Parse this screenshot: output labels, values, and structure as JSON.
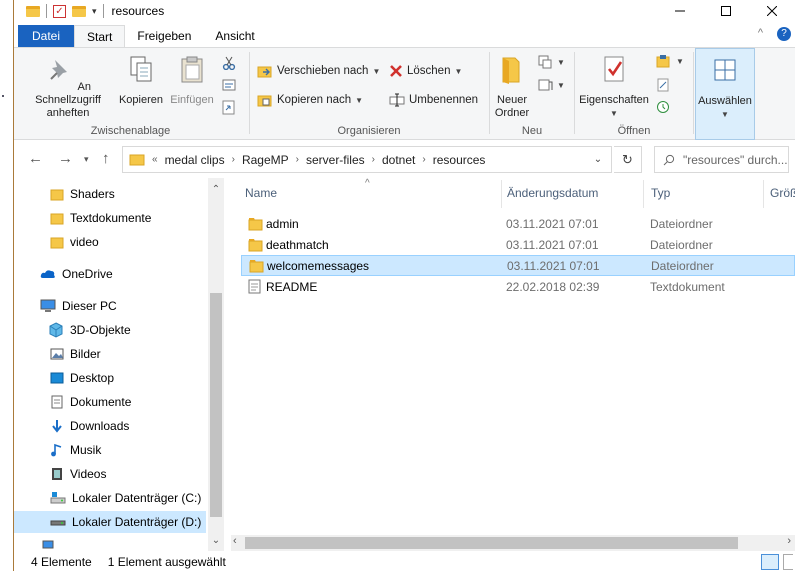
{
  "window": {
    "title": "resources",
    "controls": [
      "minimize",
      "maximize",
      "close"
    ]
  },
  "ribbon_tabs": [
    "Datei",
    "Start",
    "Freigeben",
    "Ansicht"
  ],
  "ribbon": {
    "clipboard": {
      "label": "Zwischenablage",
      "pin": "An Schnellzugriff anheften",
      "copy": "Kopieren",
      "paste": "Einfügen"
    },
    "organize": {
      "label": "Organisieren",
      "move_to": "Verschieben nach",
      "copy_to": "Kopieren nach",
      "delete": "Löschen",
      "rename": "Umbenennen"
    },
    "new": {
      "label": "Neu",
      "new_folder": "Neuer Ordner"
    },
    "open": {
      "label": "Öffnen",
      "properties": "Eigenschaften"
    },
    "select": {
      "label": "Auswählen"
    }
  },
  "address": {
    "overflow": "«",
    "crumbs": [
      "medal clips",
      "RageMP",
      "server-files",
      "dotnet",
      "resources"
    ],
    "search_placeholder": "\"resources\" durch..."
  },
  "nav_pane": {
    "items": [
      {
        "label": "Shaders",
        "icon": "folder-icon"
      },
      {
        "label": "Textdokumente",
        "icon": "folder-icon"
      },
      {
        "label": "video",
        "icon": "folder-icon"
      },
      {
        "label": "OneDrive",
        "icon": "cloud-icon"
      },
      {
        "label": "Dieser PC",
        "icon": "computer-icon"
      },
      {
        "label": "3D-Objekte",
        "icon": "cube-icon"
      },
      {
        "label": "Bilder",
        "icon": "pictures-icon"
      },
      {
        "label": "Desktop",
        "icon": "desktop-icon"
      },
      {
        "label": "Dokumente",
        "icon": "document-icon"
      },
      {
        "label": "Downloads",
        "icon": "download-icon"
      },
      {
        "label": "Musik",
        "icon": "music-icon"
      },
      {
        "label": "Videos",
        "icon": "film-icon"
      },
      {
        "label": "Lokaler Datenträger (C:)",
        "icon": "drive-icon"
      },
      {
        "label": "Lokaler Datenträger (D:)",
        "icon": "drive-icon"
      }
    ]
  },
  "file_list": {
    "columns": [
      "Name",
      "Änderungsdatum",
      "Typ",
      "Größ"
    ],
    "rows": [
      {
        "name": "admin",
        "date": "03.11.2021 07:01",
        "type": "Dateiordner",
        "icon": "folder-icon"
      },
      {
        "name": "deathmatch",
        "date": "03.11.2021 07:01",
        "type": "Dateiordner",
        "icon": "folder-icon"
      },
      {
        "name": "welcomemessages",
        "date": "03.11.2021 07:01",
        "type": "Dateiordner",
        "icon": "folder-icon"
      },
      {
        "name": "README",
        "date": "22.02.2018 02:39",
        "type": "Textdokument",
        "icon": "text-file-icon"
      }
    ]
  },
  "status": {
    "count": "4 Elemente",
    "selected": "1 Element ausgewählt"
  }
}
